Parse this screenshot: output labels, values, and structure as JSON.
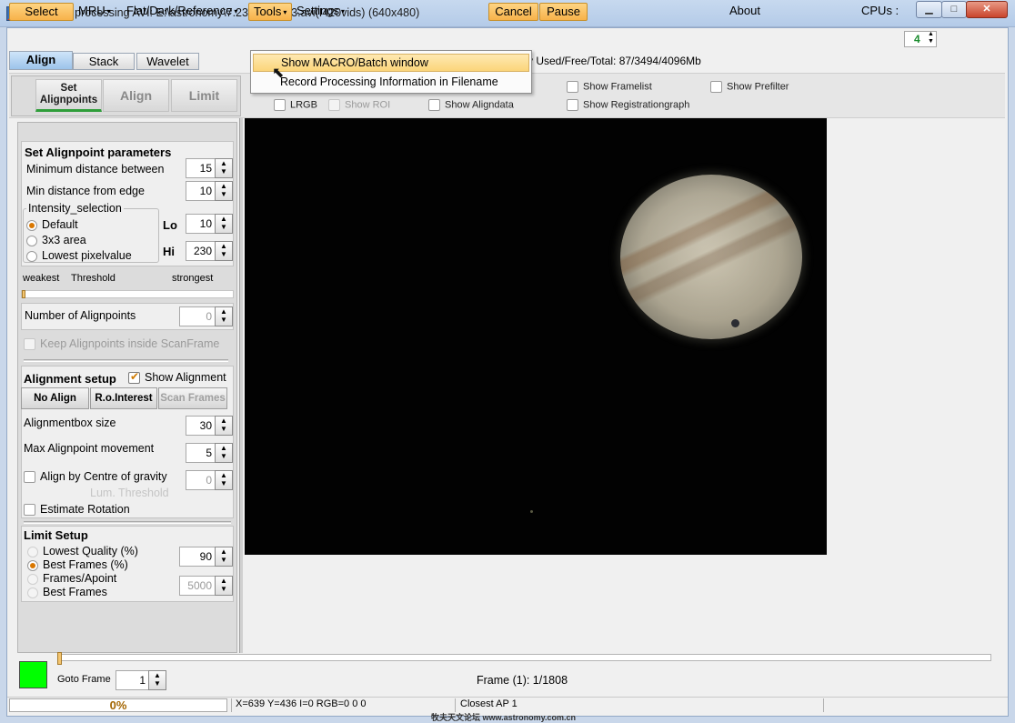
{
  "window": {
    "title": "Registax processing AVI: E:\\astronomy\\7.23\\jupiter  c3.avi(I420vids) (640x480)",
    "app_icon_text": "R",
    "icon": "registax-app-icon",
    "minimize_icon": "minimize-icon",
    "maximize_icon": "maximize-icon",
    "close_icon": "close-icon",
    "minimize_glyph": "▁",
    "maximize_glyph": "□",
    "close_glyph": "✕"
  },
  "menubar": {
    "select": "Select",
    "mru": "MRU",
    "flat_dark": "Flat/Dark/Reference",
    "tools": "Tools",
    "settings": "Settings",
    "cancel": "Cancel",
    "pause": "Pause",
    "about": "About",
    "cpus_label": "CPUs :",
    "cpus_value": "4",
    "caret": "▾"
  },
  "tools_menu": {
    "items": [
      "Show MACRO/Batch window",
      "Record Processing Information in Filename"
    ],
    "highlighted_index": 0
  },
  "tabs": {
    "items": [
      "Align",
      "Stack",
      "Wavelet"
    ],
    "active": "Align",
    "memory_text": "y Used/Free/Total: 87/3494/4096Mb"
  },
  "subtabs": {
    "set_alignpoints": "Set Alignpoints",
    "align": "Align",
    "limit": "Limit"
  },
  "toolbar_options": {
    "lrgb": "LRGB",
    "show_roi": "Show ROI",
    "show_aligndata": "Show Aligndata",
    "show_framelist": "Show Framelist",
    "show_registrationgraph": "Show Registrationgraph",
    "show_prefilter": "Show Prefilter"
  },
  "alignpoint_params": {
    "heading": "Set Alignpoint parameters",
    "min_distance_between_label": "Minimum distance between",
    "min_distance_between_value": "15",
    "min_distance_edge_label": "Min distance from edge",
    "min_distance_edge_value": "10",
    "intensity_selection_label": "Intensity_selection",
    "intensity_options": [
      "Default",
      "3x3 area",
      "Lowest pixelvalue"
    ],
    "intensity_selected": "Default",
    "lo_label": "Lo",
    "lo_value": "10",
    "hi_label": "Hi",
    "hi_value": "230",
    "weakest_label": "weakest",
    "threshold_label": "Threshold",
    "strongest_label": "strongest",
    "threshold_level": 0,
    "num_alignpoints_label": "Number of Alignpoints",
    "num_alignpoints_value": "0",
    "keep_inside_label": "Keep Alignpoints inside ScanFrame"
  },
  "alignment_setup": {
    "heading": "Alignment setup",
    "show_alignment_label": "Show Alignment",
    "show_alignment_checked": true,
    "no_align": "No Align",
    "ro_interest": "R.o.Interest",
    "scan_frames": "Scan Frames",
    "box_size_label": "Alignmentbox size",
    "box_size_value": "30",
    "max_movement_label": "Max Alignpoint movement",
    "max_movement_value": "5",
    "centre_gravity_label": "Align by Centre of gravity",
    "centre_gravity_value": "0",
    "lum_threshold_label": "Lum. Threshold",
    "estimate_rotation_label": "Estimate Rotation"
  },
  "limit_setup": {
    "heading": "Limit Setup",
    "options": [
      "Lowest Quality (%)",
      "Best Frames (%)",
      "Frames/Apoint",
      "Best Frames"
    ],
    "selected": "Best Frames (%)",
    "quality_value": "90",
    "frames_value": "5000"
  },
  "bottom": {
    "goto_frame_label": "Goto Frame",
    "goto_frame_value": "1",
    "frame_info": "Frame (1): 1/1808",
    "frame_position": 0.0,
    "status_color": "#00ff00"
  },
  "statusbar": {
    "progress_text": "0%",
    "progress_value": 0,
    "pixel_info": "X=639 Y=436 I=0 RGB=0 0 0",
    "closest_ap": "Closest AP 1"
  },
  "watermark": "牧夫天文论坛 www.astronomy.com.cn",
  "colors": {
    "accent_orange": "#f7b24a",
    "active_tab_blue": "#9cc3ea",
    "checkmark_orange": "#d07a00",
    "subtab_underline_green": "#2f9e3a"
  }
}
